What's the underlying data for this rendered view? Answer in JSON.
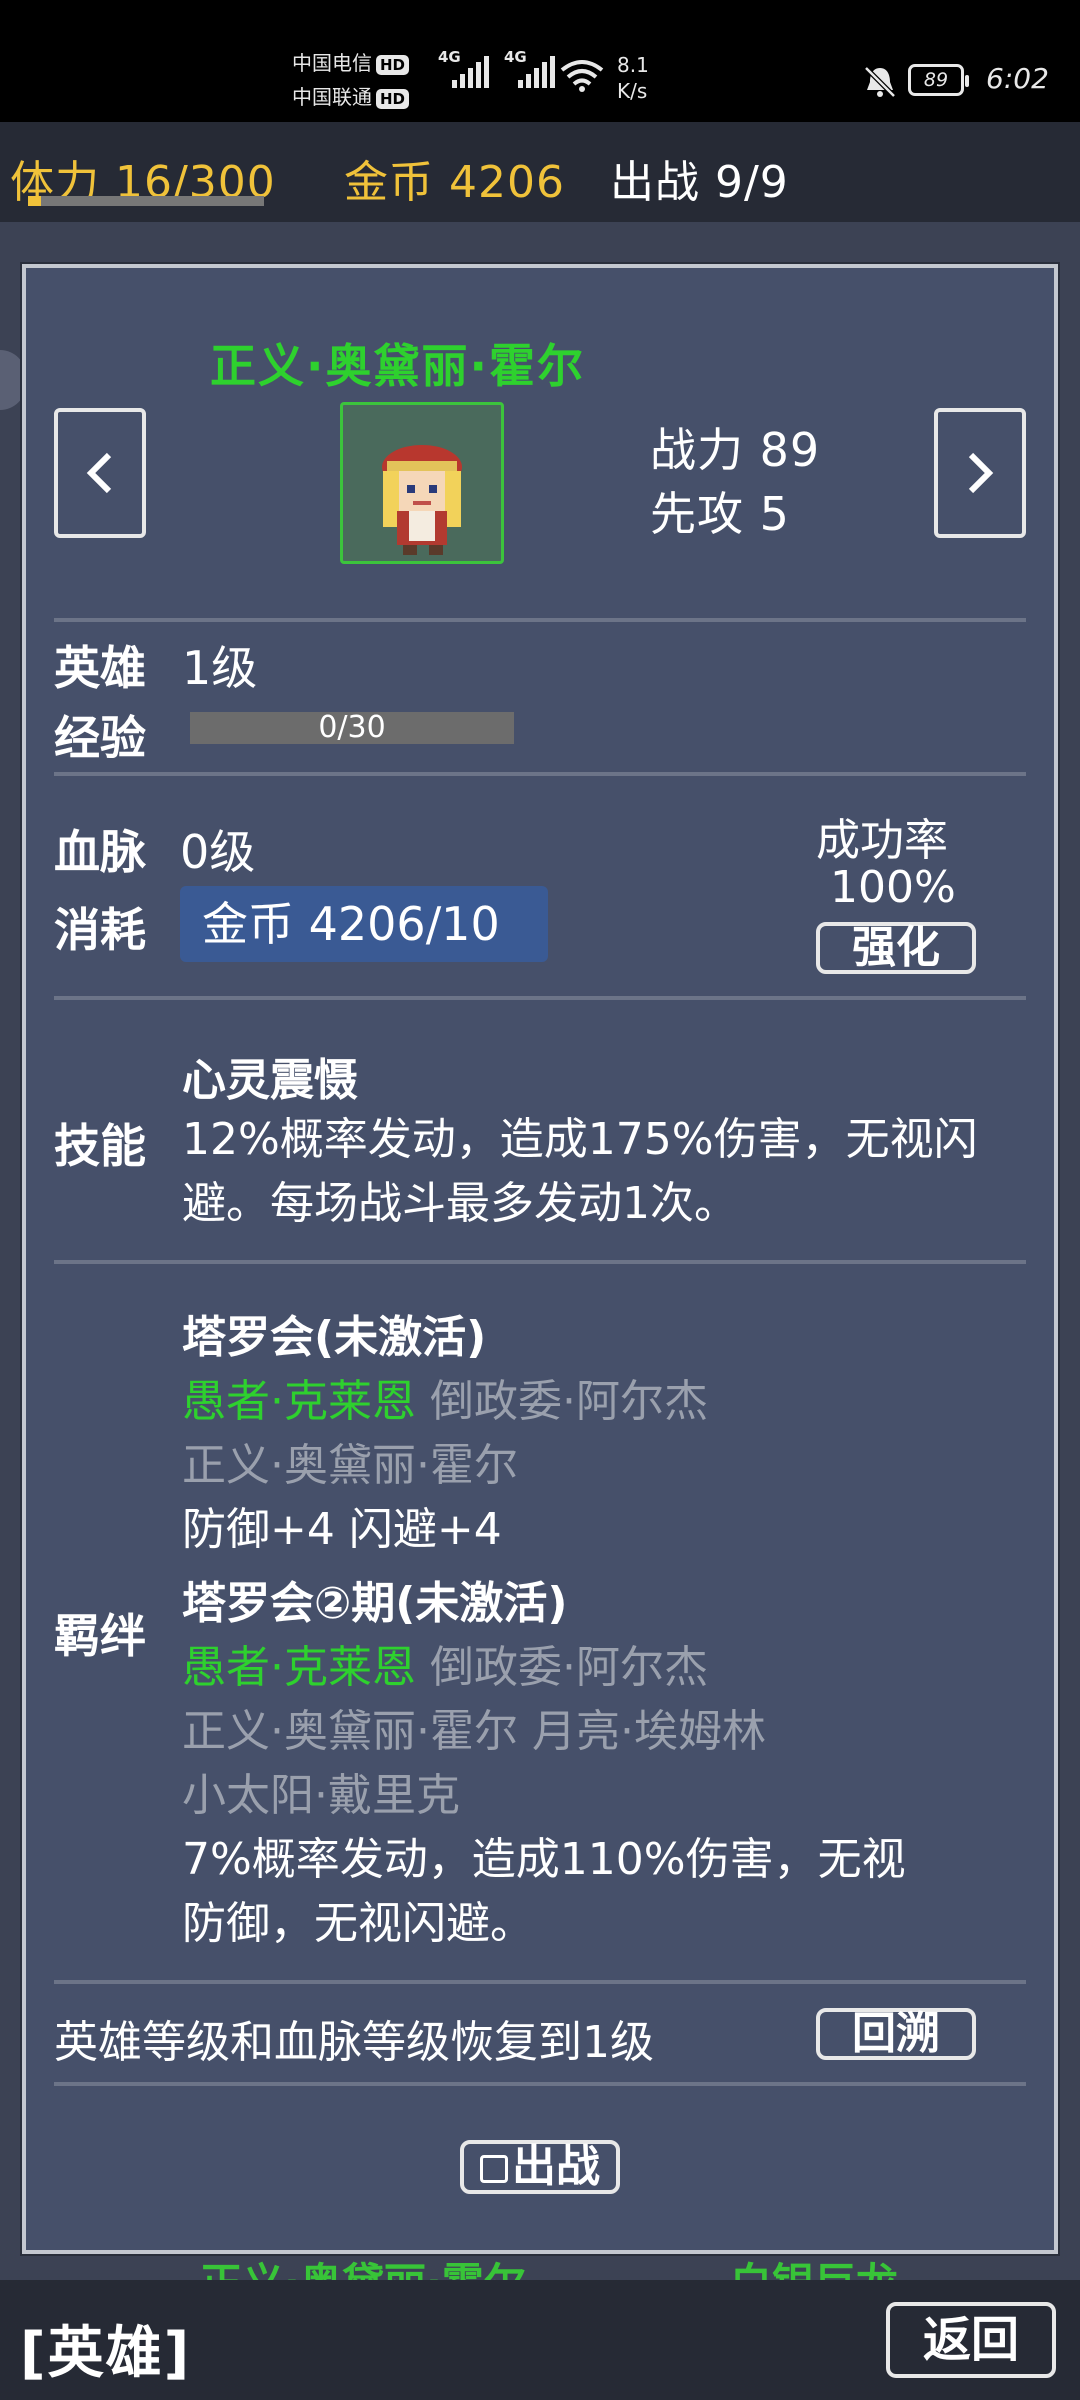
{
  "status_bar": {
    "carrier1": "中国电信",
    "carrier2": "中国联通",
    "hd": "HD",
    "net_type": "4G",
    "speed_value": "8.1",
    "speed_unit": "K/s",
    "battery": "89",
    "time": "6:02"
  },
  "resources": {
    "stamina": "体力 16/300",
    "stamina_fraction": 0.053,
    "gold": "金币 4206",
    "deploy": "出战 9/9"
  },
  "hero": {
    "name": "正义·奥黛丽·霍尔",
    "prev_icon": "chevron-left-icon",
    "next_icon": "chevron-right-icon",
    "power": "战力 89",
    "initiative": "先攻 5"
  },
  "level": {
    "label": "英雄",
    "value": "1级",
    "exp_label": "经验",
    "exp_value": "0/30",
    "exp_fraction": 0
  },
  "bloodline": {
    "label": "血脉",
    "value": "0级",
    "cost_label": "消耗",
    "cost_value": "金币 4206/10",
    "rate_label": "成功率",
    "rate_value": "100%",
    "enhance_button": "强化"
  },
  "skill": {
    "label": "技能",
    "name": "心灵震慑",
    "description": "12%概率发动，造成175%伤害，无视闪避。每场战斗最多发动1次。"
  },
  "bonds": {
    "label": "羁绊",
    "items": [
      {
        "title": "塔罗会(未激活)",
        "member1": "愚者·克莱恩",
        "member2": "倒政委·阿尔杰",
        "member3": "正义·奥黛丽·霍尔",
        "effect": "防御+4 闪避+4"
      },
      {
        "title": "塔罗会②期(未激活)",
        "member1": "愚者·克莱恩",
        "member2": "倒政委·阿尔杰",
        "member3": "正义·奥黛丽·霍尔",
        "member4": "月亮·埃姆林",
        "member5": "小太阳·戴里克",
        "effect_line1": "7%概率发动，造成110%伤害，无视",
        "effect_line2": "防御，无视闪避。"
      }
    ]
  },
  "reset": {
    "text": "英雄等级和血脉等级恢复到1级",
    "button": "回溯"
  },
  "deploy_button": "出战",
  "bottom": {
    "title": "[英雄]",
    "back_button": "返回"
  },
  "background_list": {
    "item1": "正义·奥黛丽·霍尔",
    "item2": "白银巨龙"
  },
  "colors": {
    "panel": "#46506a",
    "active_green": "#2ed12e",
    "inactive_gray": "#9aa0ad",
    "gold": "#f0c23a"
  }
}
